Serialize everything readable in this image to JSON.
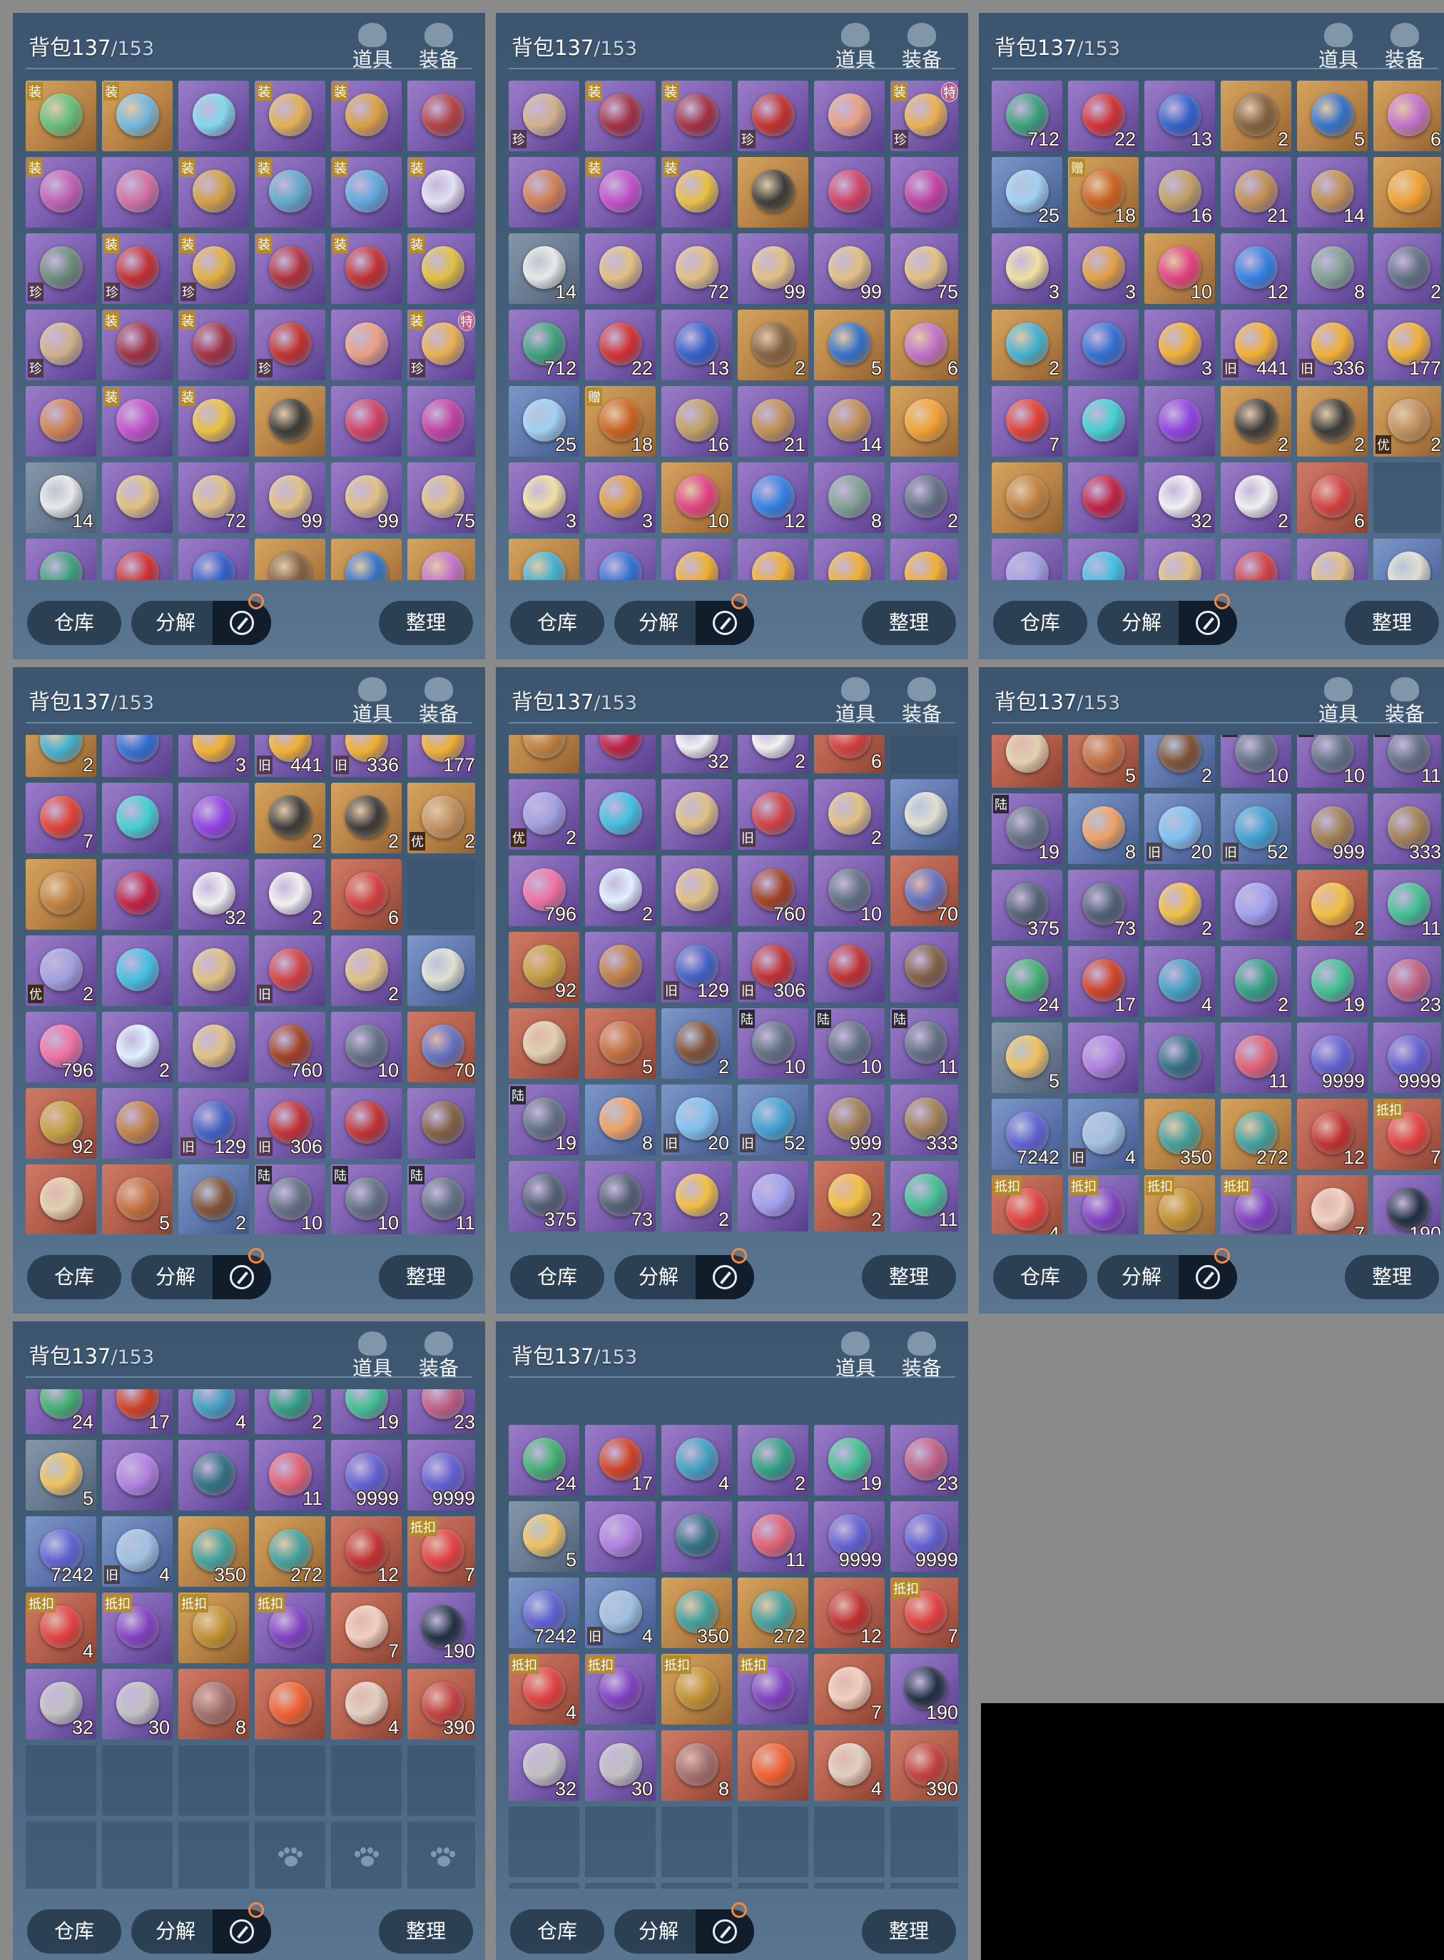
{
  "header": {
    "bag_label": "背包",
    "count": "137",
    "capacity": "/153",
    "tab_items": "道具",
    "tab_equipment": "装备"
  },
  "footer": {
    "warehouse": "仓库",
    "decompose": "分解",
    "sort": "整理"
  },
  "items": [
    {
      "q": "gold",
      "c": "#5fc07a",
      "b": "装"
    },
    {
      "q": "gold",
      "c": "#6fb7df",
      "b": "装"
    },
    {
      "q": "purple",
      "c": "#7fd8e8"
    },
    {
      "q": "purple",
      "c": "#e0b050",
      "b": "装"
    },
    {
      "q": "purple",
      "c": "#d8a040",
      "b": "装"
    },
    {
      "q": "purple",
      "c": "#b04040"
    },
    {
      "q": "purple",
      "c": "#c060b0",
      "b": "装"
    },
    {
      "q": "purple",
      "c": "#d070a0"
    },
    {
      "q": "purple",
      "c": "#d0a040",
      "b": "装"
    },
    {
      "q": "purple",
      "c": "#60a8c8",
      "b": "装"
    },
    {
      "q": "purple",
      "c": "#60a8d8",
      "b": "装"
    },
    {
      "q": "purple",
      "c": "#e0e0f0",
      "b": "装"
    },
    {
      "q": "purple",
      "c": "#6a8a78",
      "t": "珍"
    },
    {
      "q": "purple",
      "c": "#c03030",
      "b": "装",
      "t": "珍"
    },
    {
      "q": "purple",
      "c": "#e0b040",
      "b": "装",
      "t": "珍"
    },
    {
      "q": "purple",
      "c": "#b03038",
      "b": "装"
    },
    {
      "q": "purple",
      "c": "#c03030",
      "b": "装"
    },
    {
      "q": "purple",
      "c": "#e0c040",
      "b": "装"
    },
    {
      "q": "purple",
      "c": "#d0b088",
      "t": "珍"
    },
    {
      "q": "purple",
      "c": "#a03040",
      "b": "装"
    },
    {
      "q": "purple",
      "c": "#a03040",
      "b": "装"
    },
    {
      "q": "purple",
      "c": "#c03028",
      "t": "珍"
    },
    {
      "q": "purple",
      "c": "#e8a080"
    },
    {
      "q": "purple",
      "c": "#e8b050",
      "b": "装",
      "s": "特",
      "t": "珍"
    },
    {
      "q": "purple",
      "c": "#d08050"
    },
    {
      "q": "purple",
      "c": "#c050c8",
      "b": "装"
    },
    {
      "q": "purple",
      "c": "#e8c040",
      "b": "装"
    },
    {
      "q": "gold",
      "c": "#3a3a3a"
    },
    {
      "q": "purple",
      "c": "#d04060"
    },
    {
      "q": "purple",
      "c": "#c040a0"
    },
    {
      "q": "gray",
      "c": "#e8e8e8",
      "n": "14"
    },
    {
      "q": "purple",
      "c": "#e0c080"
    },
    {
      "q": "purple",
      "c": "#e0c080",
      "n": "72"
    },
    {
      "q": "purple",
      "c": "#e0c080",
      "n": "99"
    },
    {
      "q": "purple",
      "c": "#e0c080",
      "n": "99"
    },
    {
      "q": "purple",
      "c": "#e0c080",
      "n": "75"
    },
    {
      "q": "purple",
      "c": "#3aa078",
      "n": "712"
    },
    {
      "q": "purple",
      "c": "#d03030",
      "n": "22"
    },
    {
      "q": "purple",
      "c": "#3060c8",
      "n": "13"
    },
    {
      "q": "gold",
      "c": "#806040",
      "n": "2"
    },
    {
      "q": "gold",
      "c": "#3070c8",
      "n": "5"
    },
    {
      "q": "gold",
      "c": "#c070c8",
      "n": "6"
    },
    {
      "q": "blue",
      "c": "#a0d0f0",
      "n": "25"
    },
    {
      "q": "gold",
      "c": "#c86020",
      "n": "18",
      "b": "赠"
    },
    {
      "q": "purple",
      "c": "#c0a060",
      "n": "16"
    },
    {
      "q": "purple",
      "c": "#c09050",
      "n": "21"
    },
    {
      "q": "purple",
      "c": "#c09050",
      "n": "14"
    },
    {
      "q": "gold",
      "c": "#f0a030"
    },
    {
      "q": "purple",
      "c": "#f0e0a0",
      "n": "3"
    },
    {
      "q": "purple",
      "c": "#e0a040",
      "n": "3"
    },
    {
      "q": "gold",
      "c": "#e04080",
      "n": "10"
    },
    {
      "q": "purple",
      "c": "#3080e0",
      "n": "12"
    },
    {
      "q": "purple",
      "c": "#80a090",
      "n": "8"
    },
    {
      "q": "purple",
      "c": "#607080",
      "n": "2"
    },
    {
      "q": "gold",
      "c": "#40b0d0",
      "n": "2"
    },
    {
      "q": "purple",
      "c": "#3070d0"
    },
    {
      "q": "purple",
      "c": "#f0b030",
      "n": "3"
    },
    {
      "q": "purple",
      "c": "#f0b030",
      "n": "441",
      "t": "旧"
    },
    {
      "q": "purple",
      "c": "#f0b030",
      "n": "336",
      "t": "旧"
    },
    {
      "q": "purple",
      "c": "#f0b030",
      "n": "177"
    },
    {
      "q": "purple",
      "c": "#e04030",
      "n": "7"
    },
    {
      "q": "purple",
      "c": "#40d0d0"
    },
    {
      "q": "purple",
      "c": "#9040e0"
    },
    {
      "q": "gold",
      "c": "#3a3a3a",
      "n": "2"
    },
    {
      "q": "gold",
      "c": "#3a3a3a",
      "n": "2"
    },
    {
      "q": "gold",
      "c": "#c09060",
      "n": "2",
      "t": "优"
    },
    {
      "q": "gold",
      "c": "#c08040"
    },
    {
      "q": "purple",
      "c": "#c02040"
    },
    {
      "q": "purple",
      "c": "#f0f0f0",
      "n": "32"
    },
    {
      "q": "purple",
      "c": "#f0f0f0",
      "n": "2"
    },
    {
      "q": "red",
      "c": "#d04040",
      "n": "6"
    },
    {
      "q": "empty"
    },
    {
      "q": "purple",
      "c": "#a0a0e0",
      "n": "2",
      "t": "优"
    },
    {
      "q": "purple",
      "c": "#40c0e0"
    },
    {
      "q": "purple",
      "c": "#e0c080"
    },
    {
      "q": "purple",
      "c": "#d04040",
      "t": "旧"
    },
    {
      "q": "purple",
      "c": "#e0c080",
      "n": "2"
    },
    {
      "q": "blue",
      "c": "#e0e0d0"
    },
    {
      "q": "purple",
      "c": "#f070a0",
      "n": "796"
    },
    {
      "q": "purple",
      "c": "#e0f0ff",
      "n": "2"
    },
    {
      "q": "purple",
      "c": "#e0c080"
    },
    {
      "q": "purple",
      "c": "#a04020",
      "n": "760"
    },
    {
      "q": "purple",
      "c": "#607080",
      "n": "10"
    },
    {
      "q": "red",
      "c": "#6070c0",
      "n": "70"
    },
    {
      "q": "red",
      "c": "#c0a040",
      "n": "92"
    },
    {
      "q": "purple",
      "c": "#c08040"
    },
    {
      "q": "purple",
      "c": "#4060c0",
      "n": "129",
      "t": "旧"
    },
    {
      "q": "purple",
      "c": "#c03030",
      "n": "306",
      "t": "旧"
    },
    {
      "q": "purple",
      "c": "#c03030"
    },
    {
      "q": "purple",
      "c": "#806040"
    },
    {
      "q": "red",
      "c": "#e0d0b0"
    },
    {
      "q": "red",
      "c": "#c07040",
      "n": "5"
    },
    {
      "q": "blue",
      "c": "#805030",
      "n": "2"
    },
    {
      "q": "purple",
      "c": "#607080",
      "n": "10",
      "b": "陆"
    },
    {
      "q": "purple",
      "c": "#607080",
      "n": "10",
      "b": "陆"
    },
    {
      "q": "purple",
      "c": "#607080",
      "n": "11",
      "b": "陆"
    },
    {
      "q": "purple",
      "c": "#607080",
      "n": "19",
      "b": "陆"
    },
    {
      "q": "blue",
      "c": "#f0a060",
      "n": "8"
    },
    {
      "q": "blue",
      "c": "#80c0f0",
      "n": "20",
      "t": "旧"
    },
    {
      "q": "blue",
      "c": "#40a0d0",
      "n": "52",
      "t": "旧"
    },
    {
      "q": "purple",
      "c": "#a08050",
      "n": "999"
    },
    {
      "q": "purple",
      "c": "#a08050",
      "n": "333"
    },
    {
      "q": "purple",
      "c": "#506070",
      "n": "375"
    },
    {
      "q": "purple",
      "c": "#506070",
      "n": "73"
    },
    {
      "q": "purple",
      "c": "#f0c040",
      "n": "2"
    },
    {
      "q": "purple",
      "c": "#a0a0f0"
    },
    {
      "q": "red",
      "c": "#f0c040",
      "n": "2"
    },
    {
      "q": "purple",
      "c": "#40c090",
      "n": "11"
    },
    {
      "q": "purple",
      "c": "#40b070",
      "n": "24"
    },
    {
      "q": "purple",
      "c": "#d04020",
      "n": "17"
    },
    {
      "q": "purple",
      "c": "#40a0c0",
      "n": "4"
    },
    {
      "q": "purple",
      "c": "#30a080",
      "n": "2"
    },
    {
      "q": "purple",
      "c": "#40c090",
      "n": "19"
    },
    {
      "q": "purple",
      "c": "#c06080",
      "n": "23"
    },
    {
      "q": "gray",
      "c": "#f0c060",
      "n": "5"
    },
    {
      "q": "purple",
      "c": "#b080e0"
    },
    {
      "q": "purple",
      "c": "#307080"
    },
    {
      "q": "purple",
      "c": "#e06070",
      "n": "11"
    },
    {
      "q": "purple",
      "c": "#6060d0",
      "n": "9999"
    },
    {
      "q": "purple",
      "c": "#6060d0",
      "n": "9999"
    },
    {
      "q": "blue",
      "c": "#6060d0",
      "n": "7242"
    },
    {
      "q": "blue",
      "c": "#a0c0e0",
      "n": "4",
      "t": "旧"
    },
    {
      "q": "gold",
      "c": "#40a0a0",
      "n": "350"
    },
    {
      "q": "gold",
      "c": "#40a0a0",
      "n": "272"
    },
    {
      "q": "red",
      "c": "#c03030",
      "n": "12"
    },
    {
      "q": "red",
      "c": "#e04040",
      "n": "7",
      "b": "抵扣"
    },
    {
      "q": "red",
      "c": "#e04040",
      "n": "4",
      "b": "抵扣"
    },
    {
      "q": "purple",
      "c": "#8040c0",
      "n": "",
      "b": "抵扣"
    },
    {
      "q": "gold",
      "c": "#c09030",
      "n": "",
      "b": "抵扣"
    },
    {
      "q": "purple",
      "c": "#8040c0",
      "n": "",
      "b": "抵扣"
    },
    {
      "q": "red",
      "c": "#f0d0c0",
      "n": "7"
    },
    {
      "q": "purple",
      "c": "#203040",
      "n": "190"
    },
    {
      "q": "purple",
      "c": "#c0c0c0",
      "n": "32"
    },
    {
      "q": "purple",
      "c": "#c0c0c0",
      "n": "30"
    },
    {
      "q": "red",
      "c": "#a07070",
      "n": "8"
    },
    {
      "q": "red",
      "c": "#f06030"
    },
    {
      "q": "red",
      "c": "#e0d0c0",
      "n": "4"
    },
    {
      "q": "red",
      "c": "#c04040",
      "n": "390"
    }
  ],
  "panels": [
    {
      "start": 0,
      "offset": 0
    },
    {
      "start": 18,
      "offset": 0
    },
    {
      "start": 36,
      "offset": 0
    },
    {
      "start": 54,
      "offset": 40
    },
    {
      "start": 66,
      "offset": 45
    },
    {
      "start": 90,
      "offset": 25
    },
    {
      "start": 108,
      "offset": 36
    },
    {
      "start": 108,
      "offset": -50,
      "rows": 6,
      "plus": true
    }
  ]
}
